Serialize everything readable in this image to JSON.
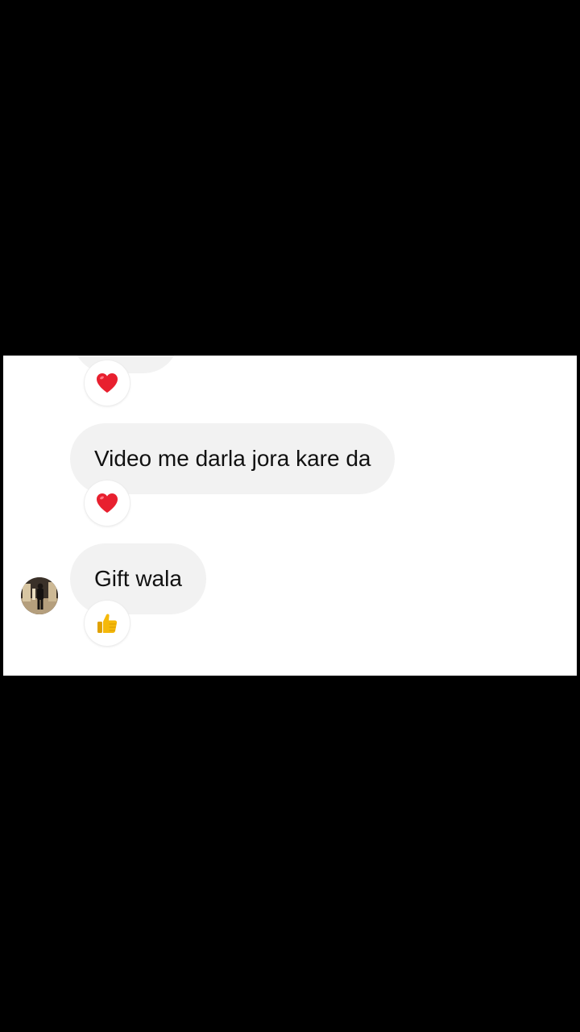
{
  "messages": [
    {
      "text": "",
      "reaction": "heart-icon"
    },
    {
      "text": "Video me darla jora kare da",
      "reaction": "heart-icon"
    },
    {
      "text": "Gift wala",
      "reaction": "thumbs-up-icon"
    }
  ],
  "colors": {
    "background": "#000000",
    "panel": "#ffffff",
    "bubble": "#f2f2f2",
    "heart": "#e8202f",
    "thumb": "#f5b90a"
  }
}
